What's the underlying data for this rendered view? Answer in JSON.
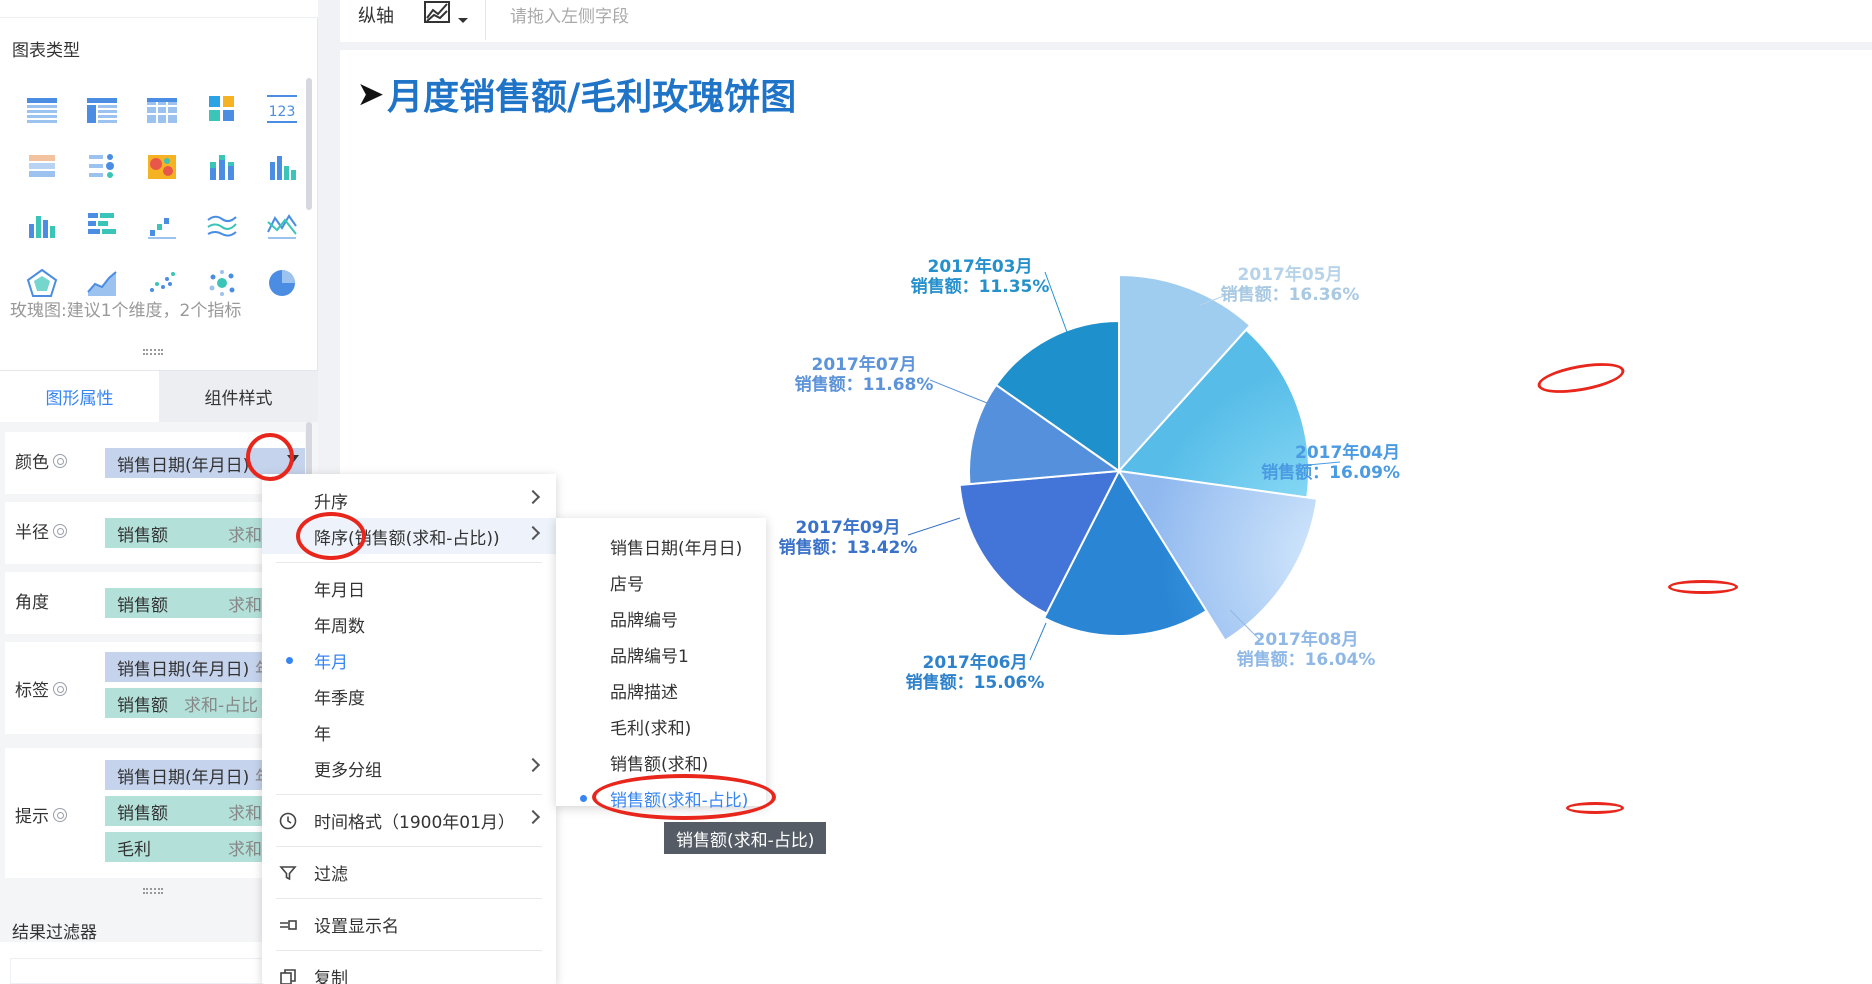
{
  "left_panel": {
    "chart_type_title": "图表类型",
    "hint": "玫瑰图:建议1个维度，2个指标",
    "tabs": [
      {
        "label": "图形属性",
        "active": true
      },
      {
        "label": "组件样式",
        "active": false
      }
    ],
    "props": {
      "color": {
        "label": "颜色",
        "field": "销售日期(年月日)",
        "tail": "年"
      },
      "radius": {
        "label": "半径",
        "field": "销售额",
        "agg": "求和"
      },
      "angle": {
        "label": "角度",
        "field": "销售额",
        "agg": "求和"
      },
      "label": {
        "label": "标签",
        "field1": "销售日期(年月日)",
        "tail1": "年",
        "field2": "销售额",
        "agg2": "求和-占比"
      },
      "tooltip": {
        "label": "提示",
        "field1": "销售日期(年月日)",
        "tail1": "年",
        "field2": "销售额",
        "agg2": "求和",
        "field3": "毛利",
        "agg3": "求和"
      }
    },
    "result_filter_title": "结果过滤器",
    "chart_icons": [
      "table-icon",
      "grouped-table-icon",
      "cross-table-icon",
      "kpi-matrix-icon",
      "number-card-icon",
      "text-table-icon",
      "dot-table-icon",
      "heatmap-icon",
      "stacked-bar-icon",
      "column-bar-icon",
      "bar-chart-icon",
      "horizontal-bar-icon",
      "step-chart-icon",
      "multi-line-icon",
      "line-chart-icon",
      "radar-icon",
      "area-chart-icon",
      "scatter-icon",
      "bubble-icon",
      "pie-icon"
    ]
  },
  "topbar": {
    "axis_label": "纵轴",
    "placeholder": "请拖入左侧字段"
  },
  "chart": {
    "title": "月度销售额/毛利玫瑰饼图",
    "colors": {
      "accent": "#3685f2",
      "title": "#1f74c8",
      "annotation": "#e8261b"
    }
  },
  "chart_data": {
    "type": "pie",
    "subtype": "rose",
    "slices": [
      {
        "label": "2017年05月",
        "measure": "销售额",
        "value_text": "16.36%",
        "value": 16.36,
        "color": "#b6d9f2"
      },
      {
        "label": "2017年04月",
        "measure": "销售额",
        "value_text": "16.09%",
        "value": 16.09,
        "color": "#6cc3ec"
      },
      {
        "label": "2017年08月",
        "measure": "销售额",
        "value_text": "16.04%",
        "value": 16.04,
        "color": "#a9ccf5"
      },
      {
        "label": "2017年06月",
        "measure": "销售额",
        "value_text": "15.06%",
        "value": 15.06,
        "color": "#3f93de"
      },
      {
        "label": "2017年09月",
        "measure": "销售额",
        "value_text": "13.42%",
        "value": 13.42,
        "color": "#4f7fdf"
      },
      {
        "label": "2017年07月",
        "measure": "销售额",
        "value_text": "11.68%",
        "value": 11.68,
        "color": "#6da7e8"
      },
      {
        "label": "2017年03月",
        "measure": "销售额",
        "value_text": "11.35%",
        "value": 11.35,
        "color": "#2f9fd8"
      }
    ]
  },
  "menu": {
    "items": {
      "asc": "升序",
      "desc": "降序(销售额(求和-占比))",
      "ymd": "年月日",
      "yweek": "年周数",
      "ym": "年月",
      "yq": "年季度",
      "y": "年",
      "more": "更多分组",
      "timefmt": "时间格式（1900年01月）",
      "filter": "过滤",
      "rename": "设置显示名",
      "copy": "复制"
    },
    "submenu": [
      "销售日期(年月日)",
      "店号",
      "品牌编号",
      "品牌编号1",
      "品牌描述",
      "毛利(求和)",
      "销售额(求和)",
      "销售额(求和-占比)"
    ],
    "tooltip": "销售额(求和-占比)"
  }
}
